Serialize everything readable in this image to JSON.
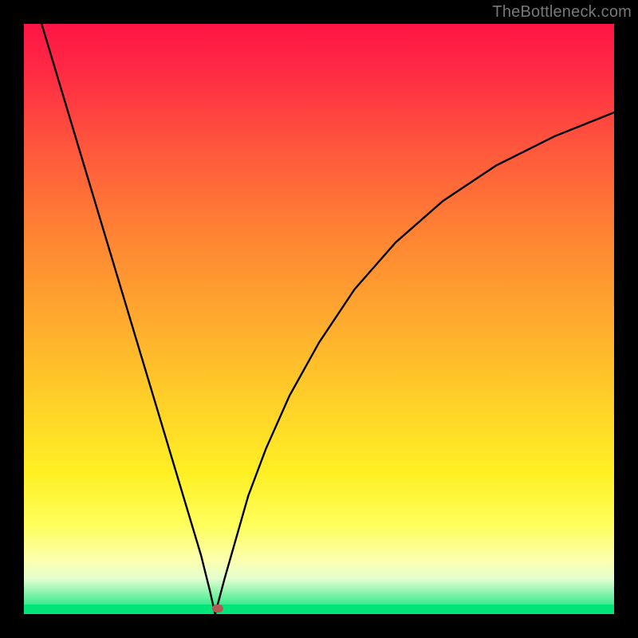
{
  "watermark": "TheBottleneck.com",
  "chart_data": {
    "type": "line",
    "title": "",
    "xlabel": "",
    "ylabel": "",
    "xlim": [
      0,
      100
    ],
    "ylim": [
      0,
      100
    ],
    "grid": false,
    "series": [
      {
        "name": "bottleneck-curve-left",
        "x": [
          3,
          6,
          9,
          12,
          15,
          18,
          21,
          24,
          27,
          30,
          31.5,
          32.4
        ],
        "values": [
          100,
          90,
          80,
          70,
          60,
          50,
          40,
          30,
          20,
          10,
          4,
          0
        ]
      },
      {
        "name": "bottleneck-curve-right",
        "x": [
          32.4,
          34,
          36,
          38,
          41,
          45,
          50,
          56,
          63,
          71,
          80,
          90,
          100
        ],
        "values": [
          0,
          6,
          13,
          20,
          28,
          37,
          46,
          55,
          63,
          70,
          76,
          81,
          85
        ]
      }
    ],
    "marker": {
      "x": 32.9,
      "y": 1.0,
      "color": "#b55a53"
    },
    "gradient_stops": [
      {
        "pos": 0,
        "color": "#ff1545"
      },
      {
        "pos": 8,
        "color": "#ff2a44"
      },
      {
        "pos": 22,
        "color": "#ff5a3c"
      },
      {
        "pos": 36,
        "color": "#ff8433"
      },
      {
        "pos": 50,
        "color": "#ffaa2e"
      },
      {
        "pos": 64,
        "color": "#ffd028"
      },
      {
        "pos": 76,
        "color": "#fff024"
      },
      {
        "pos": 85,
        "color": "#fffe5c"
      },
      {
        "pos": 91,
        "color": "#fbffb0"
      },
      {
        "pos": 94,
        "color": "#e3ffcf"
      },
      {
        "pos": 100,
        "color": "#00e47a"
      }
    ]
  }
}
